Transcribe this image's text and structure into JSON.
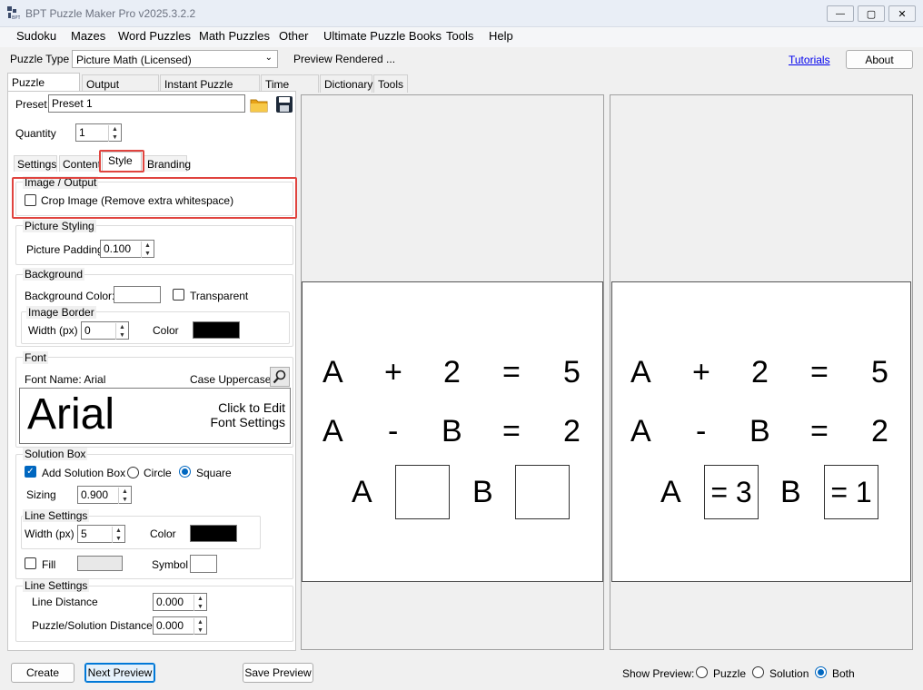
{
  "window": {
    "title": "BPT Puzzle Maker Pro v2025.3.2.2",
    "controls": {
      "minimize": "—",
      "maximize": "▢",
      "close": "✕"
    }
  },
  "menu": [
    "Sudoku",
    "Mazes",
    "Word Puzzles",
    "Math Puzzles",
    "Other",
    "Ultimate Puzzle Books",
    "Tools",
    "Help"
  ],
  "toolbar": {
    "puzzle_type_label": "Puzzle Type",
    "puzzle_type_value": "Picture Math (Licensed)",
    "status": "Preview Rendered ...",
    "tutorials_link": "Tutorials",
    "about_button": "About"
  },
  "main_tabs": [
    "Puzzle Settings",
    "Output Settings",
    "Instant Puzzle Books",
    "Time Saver",
    "Dictionary",
    "Tools"
  ],
  "preset": {
    "label": "Preset",
    "value": "Preset 1"
  },
  "quantity": {
    "label": "Quantity",
    "value": "1"
  },
  "sub_tabs": [
    "Settings",
    "Content",
    "Style",
    "Branding"
  ],
  "image_output": {
    "title": "Image / Output",
    "crop_label": "Crop Image (Remove extra whitespace)",
    "crop_checked": false
  },
  "picture_styling": {
    "title": "Picture Styling",
    "padding_label": "Picture Padding",
    "padding_value": "0.100"
  },
  "background": {
    "title": "Background",
    "color_label": "Background Color:",
    "color_value": "#ffffff",
    "transparent_label": "Transparent",
    "border_title": "Image Border",
    "width_label": "Width (px)",
    "width_value": "0",
    "color2_label": "Color",
    "border_color": "#000000"
  },
  "font": {
    "title": "Font",
    "name_label": "Font Name: Arial",
    "case_label": "Case Uppercase",
    "sample": "Arial",
    "edit_line1": "Click to Edit",
    "edit_line2": "Font Settings"
  },
  "solution_box": {
    "title": "Solution Box",
    "add_label": "Add Solution Box",
    "add_checked": true,
    "circle_label": "Circle",
    "square_label": "Square",
    "selected_shape": "Square",
    "sizing_label": "Sizing",
    "sizing_value": "0.900",
    "line_title": "Line Settings",
    "width_label": "Width (px)",
    "width_value": "5",
    "color_label": "Color",
    "line_color": "#000000",
    "fill_label": "Fill",
    "fill_color": "#e8e8e8",
    "symbol_label": "Symbol"
  },
  "line_settings": {
    "title": "Line Settings",
    "distance_label": "Line Distance",
    "distance_value": "0.000",
    "ps_distance_label": "Puzzle/Solution Distance",
    "ps_distance_value": "0.000"
  },
  "puzzle_preview": {
    "row1": [
      "A",
      "+",
      "2",
      "=",
      "5"
    ],
    "row2": [
      "A",
      "-",
      "B",
      "=",
      "2"
    ],
    "row3": [
      "A",
      "",
      "B",
      ""
    ]
  },
  "solution_preview": {
    "row1": [
      "A",
      "+",
      "2",
      "=",
      "5"
    ],
    "row2": [
      "A",
      "-",
      "B",
      "=",
      "2"
    ],
    "row3": [
      "A",
      "= 3",
      "B",
      "= 1"
    ]
  },
  "footer": {
    "create": "Create",
    "next_preview": "Next Preview",
    "save_preview": "Save Preview",
    "show_preview_label": "Show Preview:",
    "options": [
      "Puzzle",
      "Solution",
      "Both"
    ],
    "selected": "Both"
  }
}
